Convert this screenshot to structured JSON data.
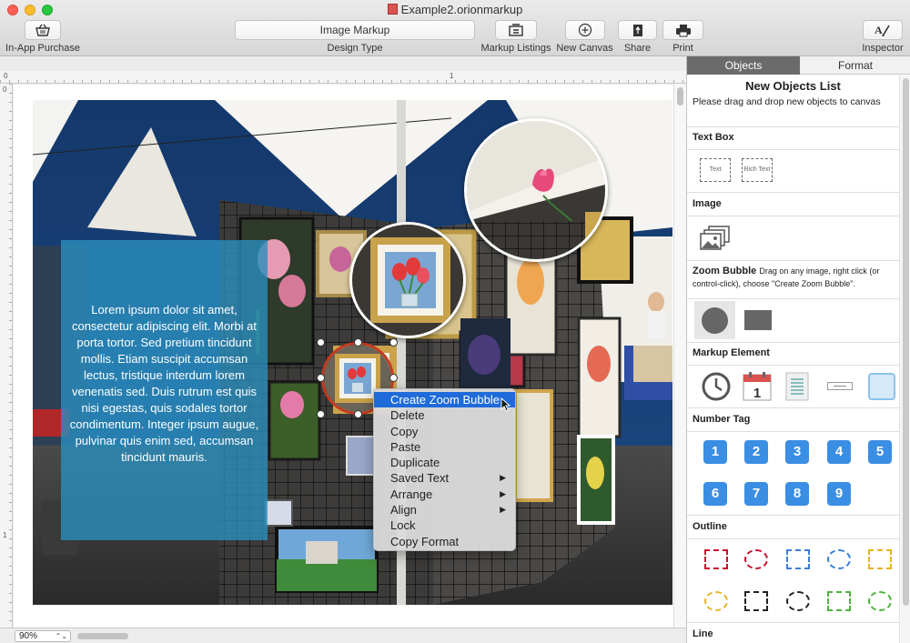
{
  "window": {
    "title": "Example2.orionmarkup"
  },
  "toolbar": {
    "in_app_purchase": "In-App Purchase",
    "design_type_value": "Image Markup",
    "design_type_label": "Design Type",
    "markup_listings": "Markup Listings",
    "new_canvas": "New Canvas",
    "share": "Share",
    "print": "Print",
    "inspector": "Inspector"
  },
  "ruler": {
    "h0": "0",
    "h1": "1",
    "v0": "0",
    "v1": "1"
  },
  "canvas": {
    "lorem": "Lorem ipsum dolor sit amet, consectetur adipiscing elit. Morbi at porta tortor. Sed pretium tincidunt mollis. Etiam suscipit accumsan lectus, tristique interdum lorem venenatis sed. Duis rutrum est quis nisi egestas, quis sodales tortor condimentum. Integer ipsum augue, pulvinar quis enim sed, accumsan tincidunt mauris."
  },
  "context_menu": {
    "items": [
      {
        "label": "Create Zoom Bubble",
        "submenu": false
      },
      {
        "label": "Delete",
        "submenu": false
      },
      {
        "label": "Copy",
        "submenu": false
      },
      {
        "label": "Paste",
        "submenu": false
      },
      {
        "label": "Duplicate",
        "submenu": false
      },
      {
        "label": "Saved Text",
        "submenu": true
      },
      {
        "label": "Arrange",
        "submenu": true
      },
      {
        "label": "Align",
        "submenu": true
      },
      {
        "label": "Lock",
        "submenu": false
      },
      {
        "label": "Copy Format",
        "submenu": false
      }
    ],
    "submenu_arrow": "▶"
  },
  "statusbar": {
    "zoom": "90%"
  },
  "sidebar": {
    "tabs": [
      "Objects",
      "Format"
    ],
    "title": "New Objects List",
    "subtitle": "Please drag and drop new objects to canvas",
    "sections": {
      "text_box": "Text Box",
      "image": "Image",
      "zoom_bubble": "Zoom Bubble",
      "zoom_bubble_desc": "Drag on any image, right click (or control-click), choose \"Create Zoom Bubble\".",
      "markup_element": "Markup Element",
      "number_tag": "Number Tag",
      "outline": "Outline",
      "line": "Line"
    },
    "text_items": [
      "Text",
      "Rich Text"
    ],
    "number_tags": [
      "1",
      "2",
      "3",
      "4",
      "5",
      "6",
      "7",
      "8",
      "9"
    ],
    "outline_colors": [
      "#c8102e",
      "#c8102e",
      "#3a7fd5",
      "#3a7fd5",
      "#e6b422",
      "#e6b422",
      "#222222",
      "#222222",
      "#4db33d",
      "#4db33d"
    ]
  }
}
